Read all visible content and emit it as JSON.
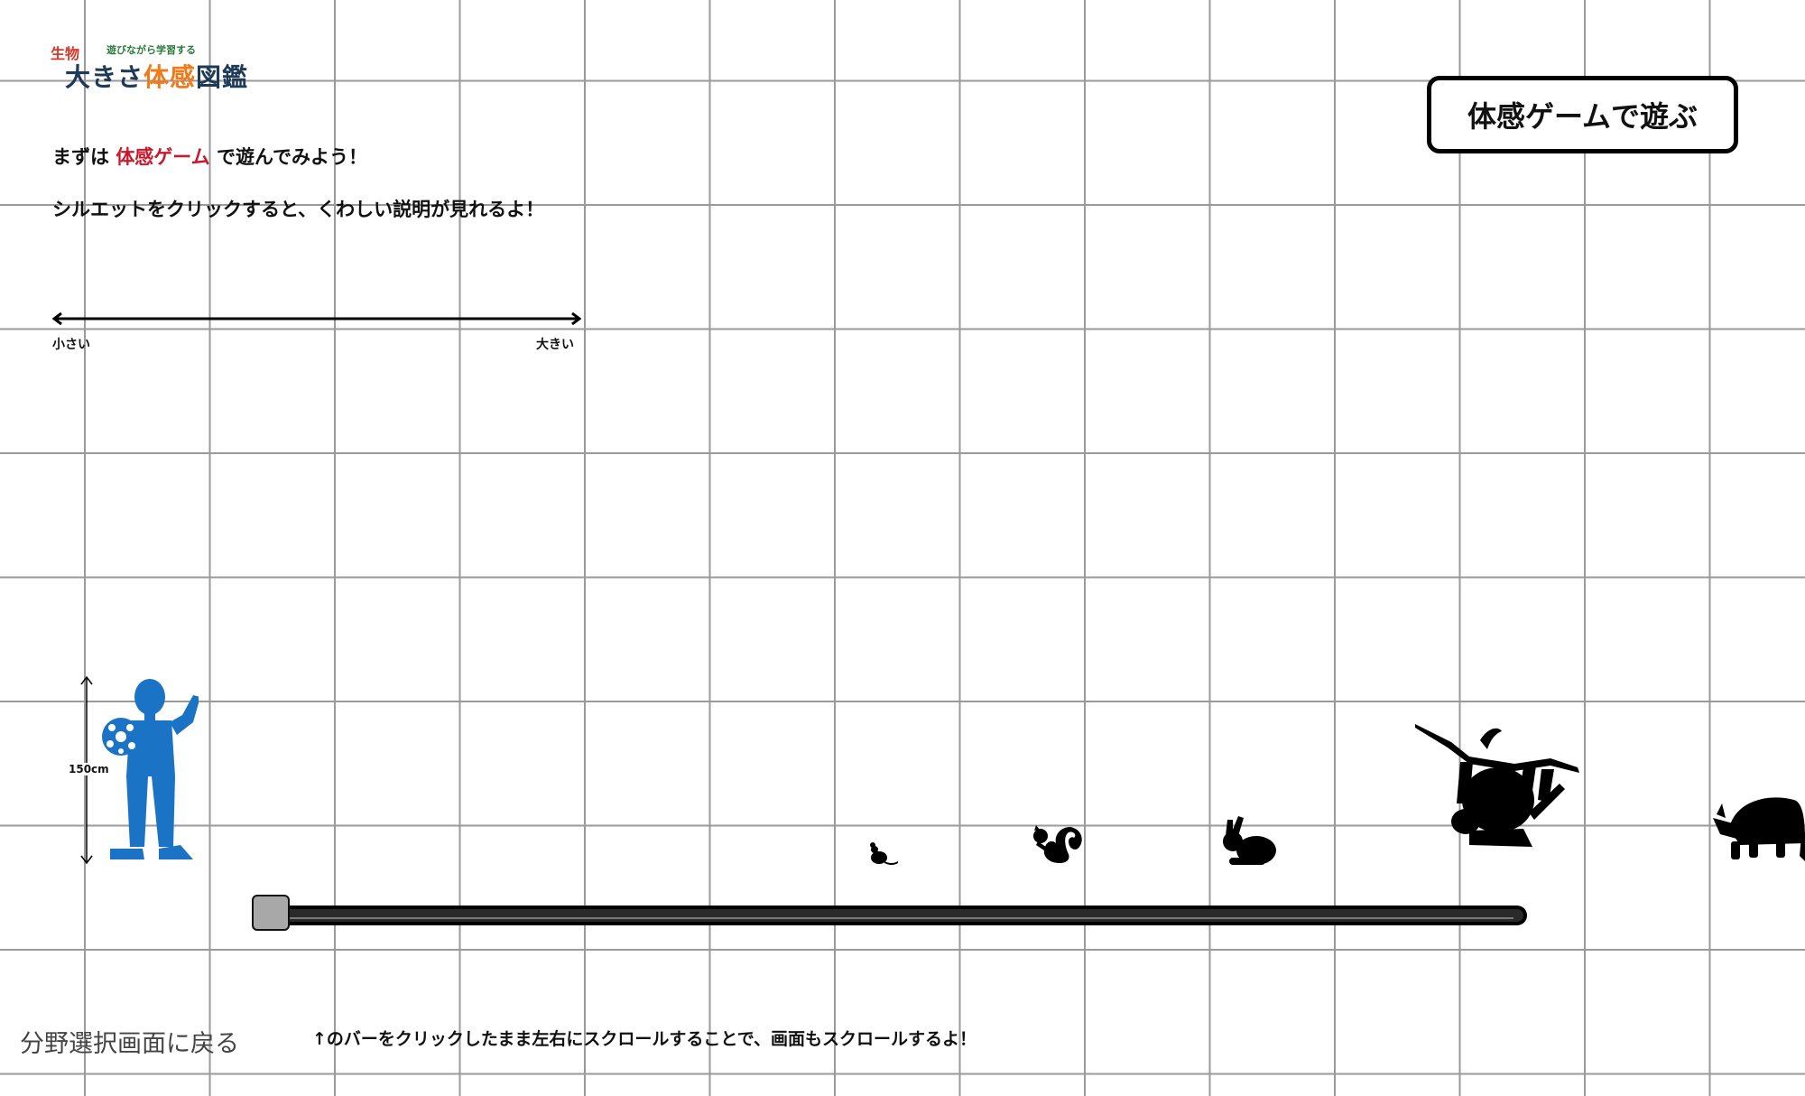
{
  "logo": {
    "category": "生物",
    "tagline": "遊びながら学習する",
    "title_part1": "大きさ",
    "title_part2": "体感",
    "title_part3": "図鑑"
  },
  "intro": {
    "line1_before": "まずは",
    "line1_accent": "体感ゲーム",
    "line1_after": "で遊んでみよう！",
    "line2": "シルエットをクリックすると、くわしい説明が見れるよ！"
  },
  "scale_legend": {
    "small_label": "小さい",
    "large_label": "大きい"
  },
  "game_button": {
    "label": "体感ゲームで遊ぶ"
  },
  "reference": {
    "height_label": "150cm"
  },
  "animals": [
    {
      "name": "mouse"
    },
    {
      "name": "squirrel"
    },
    {
      "name": "rabbit"
    },
    {
      "name": "sloth"
    },
    {
      "name": "armadillo"
    }
  ],
  "scroll": {
    "position": 0
  },
  "footer": {
    "back_label": "分野選択画面に戻る",
    "hint": "↑のバーをクリックしたまま左右にスクロールすることで、画面もスクロールするよ！"
  },
  "colors": {
    "accent_red": "#c8192a",
    "child_blue": "#1a73c4",
    "logo_orange": "#ef7b1a",
    "grid": "#9a9a9a"
  }
}
